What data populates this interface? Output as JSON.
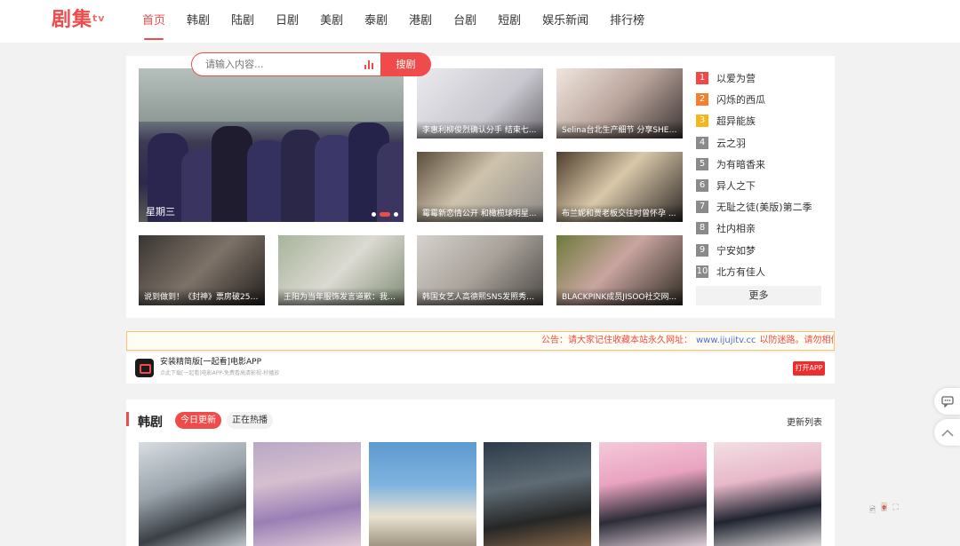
{
  "logo": {
    "text": "剧集",
    "suffix": "tv"
  },
  "nav": [
    "首页",
    "韩剧",
    "陆剧",
    "日剧",
    "美剧",
    "泰剧",
    "港剧",
    "台剧",
    "短剧",
    "娱乐新闻",
    "排行榜"
  ],
  "search": {
    "placeholder": "请输入内容...",
    "button": "搜剧"
  },
  "slider": {
    "caption": "星期三",
    "active_dot": 2,
    "dot_count": 3
  },
  "news": [
    "李惠利柳俊烈确认分手 结束七...",
    "Selina台北生产细节 分享SHE姐...",
    "霉霉新恋情公开 和橄榄球明星...",
    "布兰妮和贾老板交往时曾怀孕 ...",
    "说到做到！《封神》票房破25亿...",
    "王阳为当年服饰发言道歉：我的...",
    "韩国女艺人高德熙SNS发照秀美貌",
    "BLACKPINK成员JISOO社交网..."
  ],
  "ranking": {
    "items": [
      "以爱为营",
      "闪烁的西瓜",
      "超异能族",
      "云之羽",
      "为有暗香来",
      "异人之下",
      "无耻之徒(美版)第二季",
      "社内相亲",
      "宁安如梦",
      "北方有佳人"
    ],
    "colors": [
      "#f04848",
      "#f47f2c",
      "#f5b617",
      "#8a8a8a"
    ],
    "more": "更多"
  },
  "notice": {
    "prefix": "公告：请大家记住收藏本站永久网址：",
    "url": "www.ijujitv.cc",
    "suffix": "以防迷路。请勿相信"
  },
  "app_banner": {
    "title": "安装精简版[一起看]电影APP",
    "subtitle": "点此下载[一起看]电影APP-免费看高清影视-秒播放",
    "button": "打开APP"
  },
  "section": {
    "title": "韩剧",
    "tabs": [
      "今日更新",
      "正在热播"
    ],
    "more": "更新列表"
  },
  "tools": [
    "🖻",
    "🀄"
  ]
}
